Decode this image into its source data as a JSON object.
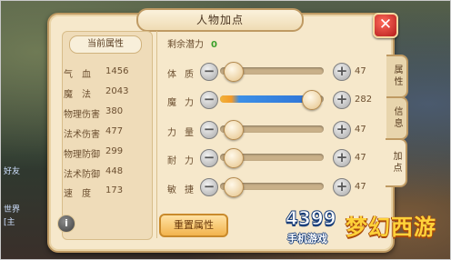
{
  "window": {
    "title": "人物加点"
  },
  "left": {
    "heading": "当前属性",
    "stats": [
      {
        "label": "气　血",
        "value": "1456"
      },
      {
        "label": "魔　法",
        "value": "2043"
      },
      {
        "label": "物理伤害",
        "value": "380"
      },
      {
        "label": "法术伤害",
        "value": "477"
      },
      {
        "label": "物理防御",
        "value": "299"
      },
      {
        "label": "法术防御",
        "value": "448"
      },
      {
        "label": "速　度",
        "value": "173"
      }
    ],
    "info_icon": "i"
  },
  "right": {
    "remain_label": "剩余潜力",
    "remain_value": "0",
    "attributes": [
      {
        "label": "体质",
        "value": "47",
        "fill": 0.0
      },
      {
        "label": "魔力",
        "value": "282",
        "fill": 0.92
      },
      {
        "label": "力量",
        "value": "47",
        "fill": 0.0
      },
      {
        "label": "耐力",
        "value": "47",
        "fill": 0.0
      },
      {
        "label": "敏捷",
        "value": "47",
        "fill": 0.0
      }
    ],
    "minus_symbol": "−",
    "plus_symbol": "+",
    "reset_label": "重置属性"
  },
  "tabs": [
    "属性",
    "信息",
    "加点"
  ],
  "active_tab": "加点",
  "close_symbol": "✕",
  "background_chat": [
    "好友",
    "世界",
    "[主"
  ],
  "logo": {
    "number": "4399",
    "subtitle": "手机游戏",
    "title": "梦幻西游"
  },
  "colors": {
    "panel": "#f6e8cb",
    "border": "#bf9a63",
    "fill_blue": "#2f73d6",
    "close_red": "#d63a2a",
    "remain_green": "#3aa02a"
  }
}
